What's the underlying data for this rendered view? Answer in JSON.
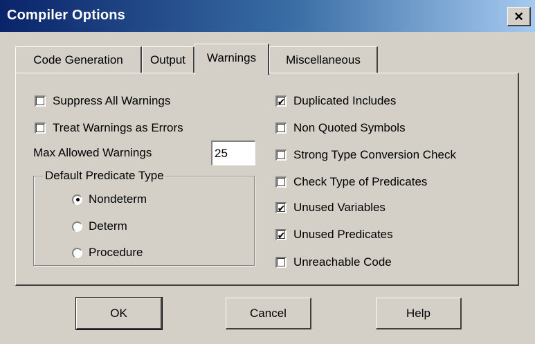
{
  "window": {
    "title": "Compiler Options",
    "close_label": "×"
  },
  "tabs": [
    "Code Generation",
    "Output",
    "Warnings",
    "Miscellaneous"
  ],
  "active_tab": "Warnings",
  "left_options": {
    "suppress_all": {
      "label": "Suppress All Warnings",
      "checked": false
    },
    "treat_as_errors": {
      "label": "Treat Warnings as Errors",
      "checked": false
    },
    "max_allowed": {
      "label": "Max Allowed Warnings",
      "value": "25"
    }
  },
  "predicate_group": {
    "label": "Default Predicate Type",
    "options": [
      "Nondeterm",
      "Determ",
      "Procedure"
    ],
    "selected": "Nondeterm"
  },
  "right_options": [
    {
      "label": "Duplicated Includes",
      "checked": true
    },
    {
      "label": "Non Quoted Symbols",
      "checked": false
    },
    {
      "label": "Strong Type Conversion Check",
      "checked": false
    },
    {
      "label": "Check Type of Predicates",
      "checked": false
    },
    {
      "label": "Unused Variables",
      "checked": true
    },
    {
      "label": "Unused Predicates",
      "checked": true
    },
    {
      "label": "Unreachable Code",
      "checked": false
    }
  ],
  "buttons": {
    "ok": "OK",
    "cancel": "Cancel",
    "help": "Help"
  }
}
